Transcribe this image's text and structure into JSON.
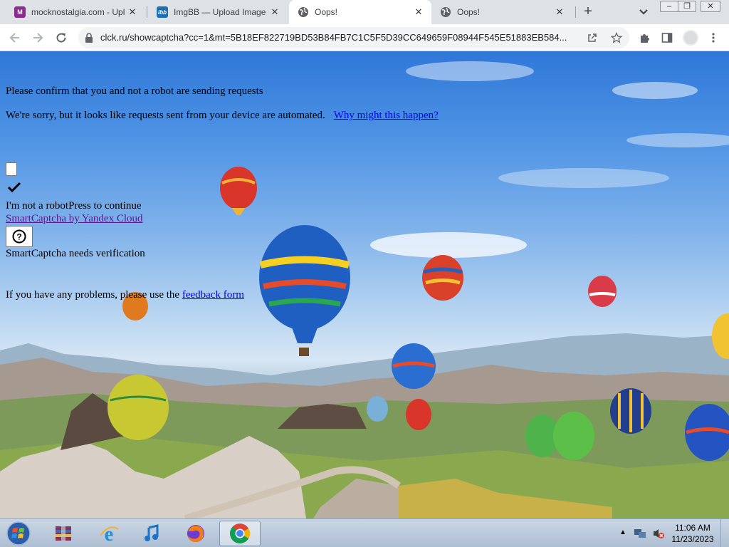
{
  "browser": {
    "tabs": [
      {
        "title": "mocknostalgia.com - Upl",
        "favicon": "mocknostalgia-m-icon",
        "active": false
      },
      {
        "title": "ImgBB — Upload Image",
        "favicon": "imgbb-icon",
        "active": false
      },
      {
        "title": "Oops!",
        "favicon": "globe-icon",
        "active": true
      },
      {
        "title": "Oops!",
        "favicon": "globe-icon",
        "active": false
      }
    ],
    "new_tab_label": "+",
    "tab_close": "✕",
    "url": "clck.ru/showcaptcha?cc=1&mt=5B18EF822719BD53B84FB7C1C5F5D39CC649659F08944F545E51883EB584..."
  },
  "page": {
    "confirm_text": "Please confirm that you and not a robot are sending requests",
    "sorry_text": "We're sorry, but it looks like requests sent from your device are automated.",
    "why_link": "Why might this happen?",
    "robot_text": "I'm not a robotPress to continue",
    "smartcaptcha_link": "SmartCaptcha by Yandex Cloud",
    "help_button": "?",
    "verification_text": "SmartCaptcha needs verification",
    "problems_prefix": "If you have any problems, please use the ",
    "feedback_link": "feedback form"
  },
  "taskbar": {
    "apps": [
      "winrar-icon",
      "internet-explorer-icon",
      "itunes-icon",
      "firefox-icon",
      "chrome-icon"
    ],
    "active_app": "chrome-icon",
    "time": "11:06 AM",
    "date": "11/23/2023"
  },
  "colors": {
    "link": "#0000ee",
    "visited_link": "#551a8b",
    "sky_top": "#2f78d8",
    "taskbar": "#c9d6e4"
  }
}
